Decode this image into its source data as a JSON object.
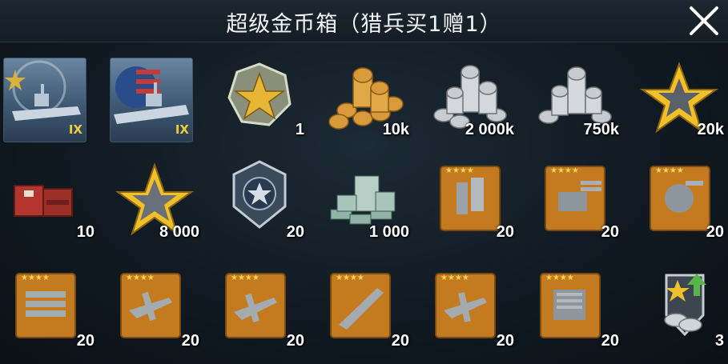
{
  "header": {
    "title": "超级金币箱（猎兵买1赠1）"
  },
  "items": [
    {
      "name": "ship-ix-a-icon",
      "tier": "IX"
    },
    {
      "name": "ship-ix-b-icon",
      "tier": "IX"
    },
    {
      "name": "gold-star-token-icon",
      "count": "1"
    },
    {
      "name": "gold-coins-icon",
      "count": "10k"
    },
    {
      "name": "silver-coins-2000k-icon",
      "count": "2 000k"
    },
    {
      "name": "silver-coins-750k-icon",
      "count": "750k"
    },
    {
      "name": "gold-star-20k-icon",
      "count": "20k"
    },
    {
      "name": "red-crate-icon",
      "count": "10"
    },
    {
      "name": "silver-star-icon",
      "count": "8 000"
    },
    {
      "name": "rank-badge-icon",
      "count": "20"
    },
    {
      "name": "cash-stacks-icon",
      "count": "1 000"
    },
    {
      "name": "radar-blueprint-icon",
      "count": "20"
    },
    {
      "name": "turret-blueprint-icon",
      "count": "20"
    },
    {
      "name": "aa-gun-blueprint-icon",
      "count": "20"
    },
    {
      "name": "torpedo-blueprint-icon",
      "count": "20"
    },
    {
      "name": "fighter-plane-blueprint-icon",
      "count": "20"
    },
    {
      "name": "bomber-plane-blueprint-icon",
      "count": "20"
    },
    {
      "name": "ship-hull-blueprint-icon",
      "count": "20"
    },
    {
      "name": "dive-bomber-blueprint-icon",
      "count": "20"
    },
    {
      "name": "engine-blueprint-icon",
      "count": "20"
    },
    {
      "name": "upgrade-badge-icon",
      "count": "3"
    }
  ]
}
